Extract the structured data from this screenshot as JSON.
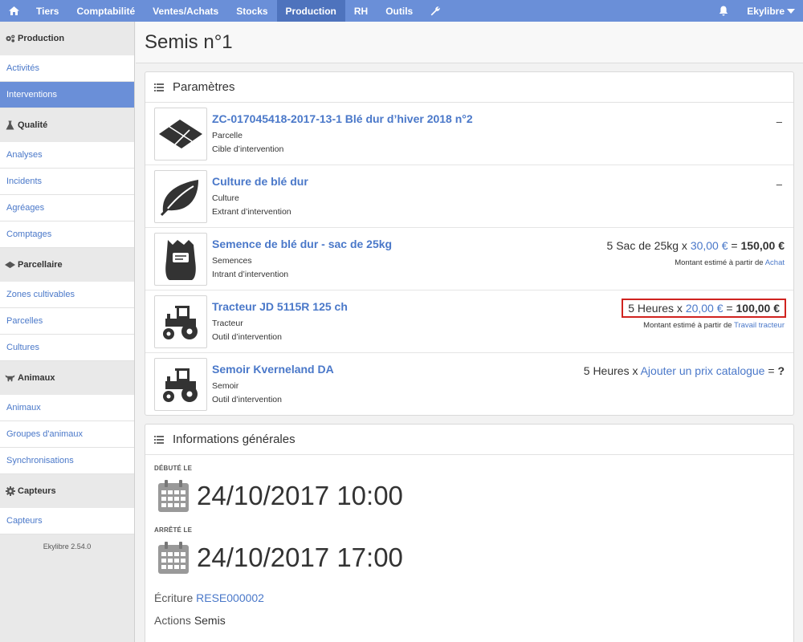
{
  "nav": {
    "items": [
      "Tiers",
      "Comptabilité",
      "Ventes/Achats",
      "Stocks",
      "Production",
      "RH",
      "Outils"
    ],
    "active": "Production",
    "user": "Ekylibre",
    "accent_color": "#6a8fd8",
    "active_color": "#4e73bd"
  },
  "sidebar": {
    "sections": [
      {
        "title": "Production",
        "icon": "gears-icon",
        "items": [
          {
            "label": "Activités"
          },
          {
            "label": "Interventions",
            "active": true
          }
        ]
      },
      {
        "title": "Qualité",
        "icon": "flask-icon",
        "items": [
          {
            "label": "Analyses"
          },
          {
            "label": "Incidents"
          },
          {
            "label": "Agréages"
          },
          {
            "label": "Comptages"
          }
        ]
      },
      {
        "title": "Parcellaire",
        "icon": "land-plot-icon",
        "items": [
          {
            "label": "Zones cultivables"
          },
          {
            "label": "Parcelles"
          },
          {
            "label": "Cultures"
          }
        ]
      },
      {
        "title": "Animaux",
        "icon": "cow-icon",
        "items": [
          {
            "label": "Animaux"
          },
          {
            "label": "Groupes d'animaux"
          },
          {
            "label": "Synchronisations"
          }
        ]
      },
      {
        "title": "Capteurs",
        "icon": "gear-icon",
        "items": [
          {
            "label": "Capteurs"
          }
        ]
      }
    ],
    "version": "Ekylibre 2.54.0"
  },
  "page": {
    "title": "Semis n°1"
  },
  "parameters": {
    "title": "Paramètres",
    "rows": [
      {
        "name": "ZC-017045418-2017-13-1 Blé dur d’hiver 2018 n°2",
        "line1": "Parcelle",
        "line2": "Cible d’intervention",
        "thumb_icon": "land-plot-icon",
        "right": "–"
      },
      {
        "name": "Culture de blé dur",
        "line1": "Culture",
        "line2": "Extrant d’intervention",
        "thumb_icon": "leaf-icon",
        "right": "–"
      },
      {
        "name": "Semence de blé dur - sac de 25kg",
        "line1": "Semences",
        "line2": "Intrant d’intervention",
        "thumb_icon": "seed-bag-icon",
        "cost": {
          "qty": "5 Sac de 25kg x",
          "price": "30,00 €",
          "total": "150,00 €",
          "note": "Montant estimé à partir de",
          "note_link": "Achat"
        }
      },
      {
        "name": "Tracteur JD 5115R 125 ch",
        "line1": "Tracteur",
        "line2": "Outil d’intervention",
        "thumb_icon": "tractor-icon",
        "cost": {
          "qty": "5 Heures x",
          "price": "20,00 €",
          "total": "100,00 €",
          "note": "Montant estimé à partir de",
          "note_link": "Travail tracteur",
          "highlight_color": "#d0231f"
        }
      },
      {
        "name": "Semoir Kverneland DA",
        "line1": "Semoir",
        "line2": "Outil d’intervention",
        "thumb_icon": "tractor-icon",
        "cost": {
          "qty": "5 Heures x",
          "link": "Ajouter un prix catalogue",
          "total": "?"
        }
      }
    ]
  },
  "general": {
    "title": "Informations générales",
    "started_label": "Débuté le",
    "started": "24/10/2017 10:00",
    "stopped_label": "Arrêté le",
    "stopped": "24/10/2017 17:00",
    "record_label": "Écriture",
    "record_value": "RESE000002",
    "actions_label": "Actions",
    "actions_value": "Semis"
  }
}
